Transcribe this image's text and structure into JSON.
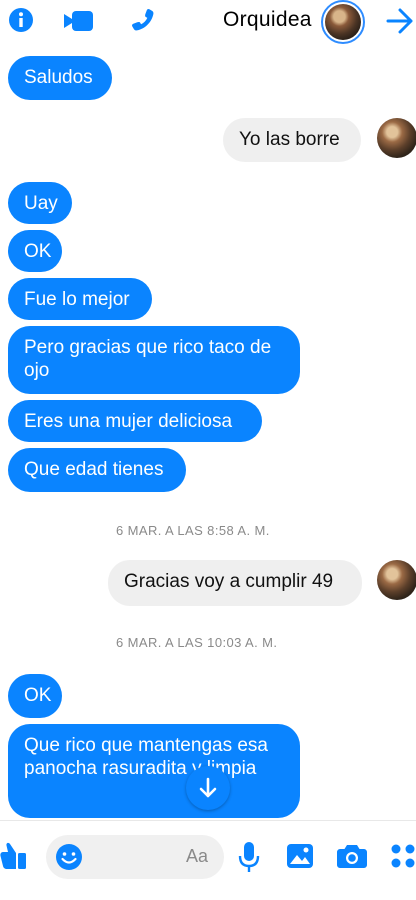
{
  "header": {
    "title": "Orquidea",
    "icons": [
      "info-icon",
      "video-call-icon",
      "phone-icon",
      "arrow-icon"
    ]
  },
  "messages": [
    {
      "side": "out",
      "text": "Saludos"
    },
    {
      "side": "in",
      "text": "Yo las borre"
    },
    {
      "side": "out",
      "text": "Uay"
    },
    {
      "side": "out",
      "text": "OK"
    },
    {
      "side": "out",
      "text": "Fue lo mejor"
    },
    {
      "side": "out",
      "text": "Pero gracias que rico taco de ojo"
    },
    {
      "side": "out",
      "text": "Eres una mujer deliciosa"
    },
    {
      "side": "out",
      "text": "Que edad tienes"
    },
    {
      "side": "in",
      "text": "Gracias voy a cumplir 49"
    },
    {
      "side": "out",
      "text": "OK"
    },
    {
      "side": "out",
      "text": "Que rico que mantengas esa panocha rasuradita y limpia"
    }
  ],
  "timestamps": [
    "6 MAR. A LAS 8:58 A. M.",
    "6 MAR. A LAS 10:03 A. M."
  ],
  "composer": {
    "placeholder": "Aa",
    "icons": [
      "like-icon",
      "emoji-icon",
      "microphone-icon",
      "gallery-icon",
      "camera-icon",
      "apps-icon"
    ]
  },
  "colors": {
    "accent": "#0a84ff",
    "incoming_bubble": "#efefef"
  }
}
